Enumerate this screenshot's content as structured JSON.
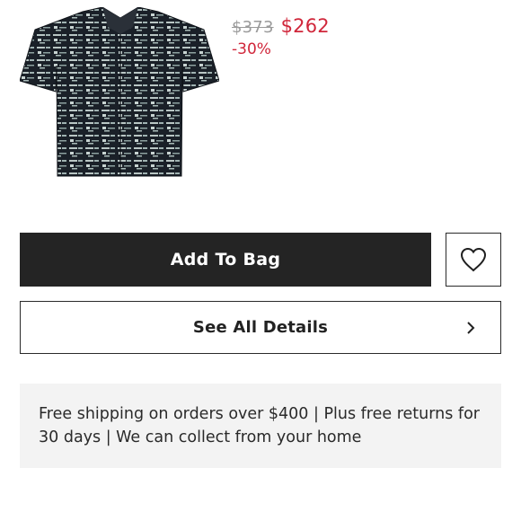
{
  "product": {
    "image_alt": "Black and white patterned short-sleeve shirt",
    "old_price": "$373",
    "new_price": "$262",
    "discount": "-30%"
  },
  "actions": {
    "add_to_bag_label": "Add To Bag",
    "wishlist_icon": "heart-icon",
    "see_details_label": "See All Details",
    "see_details_icon": "chevron-right-icon"
  },
  "shipping": {
    "message": "Free shipping on orders over $400 | Plus free returns for 30 days | We can collect from your home"
  },
  "colors": {
    "price_sale": "#d0263a",
    "price_old": "#9a9a9a",
    "button_dark": "#242424",
    "info_background": "#f3f3f3"
  }
}
